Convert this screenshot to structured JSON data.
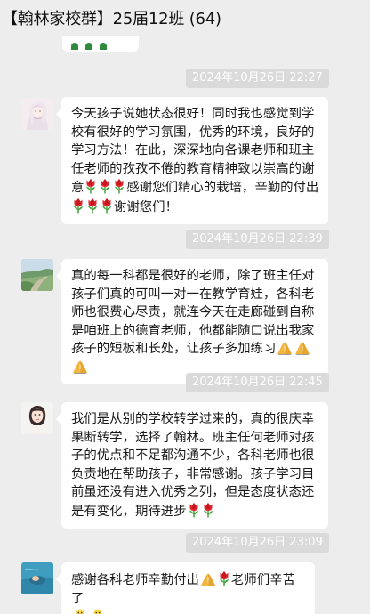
{
  "header": {
    "title": "【翰林家校群】25届12班 (64)"
  },
  "messages": [
    {
      "timestamp": "2024年10月26日 22:27",
      "avatar": "avatar-anime-girl",
      "segments": [
        "今天孩子说她状态很好！同时我也感觉到学校有很好的学习氛围，优秀的环境，良好的学习方法！在此，深深地向各课老师和班主任老师的孜孜不倦的教育精神致以崇高的谢意",
        "感谢您们精心的栽培，辛勤的付出",
        "谢谢您们！"
      ]
    },
    {
      "timestamp": "2024年10月26日 22:39",
      "avatar": "avatar-landscape",
      "segments": [
        "真的每一科都是很好的老师，除了班主任对孩子们真的可叫一对一在教学育娃，各科老师也很费心尽责，就连今天在走廊碰到自称是咱班上的德育老师，他都能随口说出我家孩子的短板和长处，让孩子多加练习"
      ]
    },
    {
      "timestamp": "2024年10月26日 22:45",
      "avatar": "avatar-woman-portrait",
      "segments": [
        "我们是从别的学校转学过来的，真的很庆幸果断转学，选择了翰林。班主任何老师对孩子的优点和不足都沟通不少，各科老师也很负责地在帮助孩子，非常感谢。孩子学习目前虽还没有进入优秀之列，但是态度状态还是有变化，期待进步"
      ]
    },
    {
      "timestamp": "2024年10月26日 23:09",
      "avatar": "avatar-water",
      "segments": [
        "感谢各科老师辛勤付出",
        "老师们辛苦了"
      ]
    }
  ],
  "emoji_names": [
    "tulip-emoji",
    "pray-emoji",
    "chick-emoji"
  ]
}
